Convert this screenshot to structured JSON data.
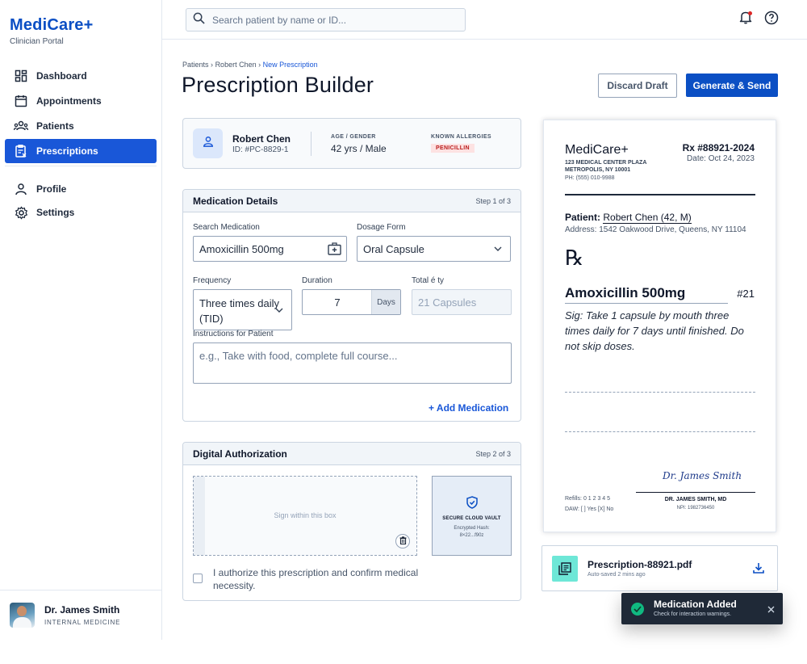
{
  "brand": {
    "name": "MediCare+",
    "subtitle": "Clinician Portal"
  },
  "nav": {
    "items": [
      {
        "label": "Dashboard",
        "icon": "dashboard-icon"
      },
      {
        "label": "Appointments",
        "icon": "calendar-icon"
      },
      {
        "label": "Patients",
        "icon": "users-icon"
      },
      {
        "label": "Prescriptions",
        "icon": "prescription-icon",
        "active": true
      }
    ],
    "secondary": [
      {
        "label": "Profile",
        "icon": "user-icon"
      },
      {
        "label": "Settings",
        "icon": "gear-icon"
      }
    ]
  },
  "user": {
    "name": "Dr. James Smith",
    "role": "INTERNAL MEDICINE"
  },
  "search": {
    "placeholder": "Search patient by name or ID..."
  },
  "breadcrumb": {
    "items": [
      "Patients",
      "Robert Chen",
      "New Prescription"
    ],
    "separator": "›"
  },
  "header": {
    "title": "Prescription Builder",
    "discard_label": "Discard Draft",
    "generate_label": "Generate & Send"
  },
  "patient": {
    "name": "Robert Chen",
    "id": "ID: #PC-8829-1",
    "age_gender_label": "AGE / GENDER",
    "age_gender": "42 yrs / Male",
    "allergies_label": "KNOWN ALLERGIES",
    "allergy": "PENICILLIN"
  },
  "medication": {
    "title": "Medication Details",
    "step": "Step 1 of 3",
    "search_label": "Search Medication",
    "search_value": "Amoxicillin 500mg",
    "dosage_label": "Dosage Form",
    "dosage_value": "Oral Capsule",
    "frequency_label": "Frequency",
    "frequency_value": "Three times daily (TID)",
    "duration_label": "Duration",
    "duration_value": "7",
    "duration_unit": "Days",
    "total_label": "Total é ty",
    "total_placeholder": "21 Capsules",
    "instructions_label": "Instructions for Patient",
    "instructions_placeholder": "e.g., Take with food, complete full course...",
    "add_label": "+ Add Medication"
  },
  "authorization": {
    "title": "Digital Authorization",
    "step": "Step 2 of 3",
    "sign_hint": "Sign within this box",
    "vault_title": "SECURE CLOUD VAULT",
    "vault_sub1": "Encrypted Hash:",
    "vault_sub2": "8×22...f90z",
    "confirm_label": "I authorize this prescription and confirm medical necessity."
  },
  "rx": {
    "brand": "MediCare+",
    "address_line1": "123 MEDICAL CENTER PLAZA",
    "address_line2": "METROPOLIS, NY 10001",
    "phone": "PH: (555) 010-9988",
    "number": "Rx #88921-2024",
    "date": "Date: Oct 24, 2023",
    "patient_label": "Patient:",
    "patient_value": "Robert Chen (42, M)",
    "patient_address": "Address: 1542 Oakwood Drive, Queens, NY 11104",
    "symbol": "℞",
    "drug": "Amoxicillin 500mg",
    "qty": "#21",
    "sig": "Sig: Take 1 capsule by mouth three times daily for 7 days until finished. Do not skip doses.",
    "signature": "Dr. James Smith",
    "doctor": "DR. JAMES SMITH, MD",
    "npi": "NPI: 1982736450",
    "refills": "Refills: 0 1 2 3 4 5",
    "daw": "DAW: [ ] Yes [X] No"
  },
  "file": {
    "name": "Prescription-88921.pdf",
    "sub": "Auto-saved 2 mins ago"
  },
  "toast": {
    "title": "Medication Added",
    "sub": "Check for interaction warnings."
  },
  "colors": {
    "primary": "#0b4fc4",
    "active_nav": "#1957d8",
    "success": "#10b981",
    "allergy": "#b91c1c"
  }
}
